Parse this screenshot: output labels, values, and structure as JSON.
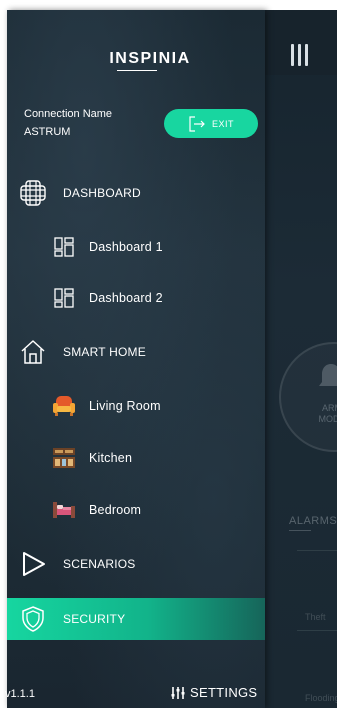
{
  "app": {
    "arm_mode_label": "ARM MODE",
    "alarms_title": "ALARMS",
    "alarm_items": [
      "Theft",
      "Flooding"
    ]
  },
  "drawer": {
    "logo": "INSPINIA",
    "connection_label": "Connection Name",
    "connection_value": "ASTRUM",
    "exit_label": "EXIT",
    "menu": [
      {
        "label": "DASHBOARD",
        "icon": "dashboard-grid-icon"
      },
      {
        "label": "Dashboard 1",
        "icon": "dashboard-layout-icon"
      },
      {
        "label": "Dashboard 2",
        "icon": "dashboard-layout-icon"
      },
      {
        "label": "SMART HOME",
        "icon": "house-icon"
      },
      {
        "label": "Living Room",
        "icon": "armchair-icon"
      },
      {
        "label": "Kitchen",
        "icon": "kitchen-cabinet-icon"
      },
      {
        "label": "Bedroom",
        "icon": "bed-icon"
      },
      {
        "label": "SCENARIOS",
        "icon": "play-triangle-icon"
      },
      {
        "label": "SECURITY",
        "icon": "shield-icon",
        "active": true
      }
    ],
    "version": "v1.1.1",
    "settings_label": "SETTINGS"
  },
  "colors": {
    "accent": "#18d6a0",
    "drawer_bg": "#1f2f3a",
    "text": "#ffffff"
  }
}
